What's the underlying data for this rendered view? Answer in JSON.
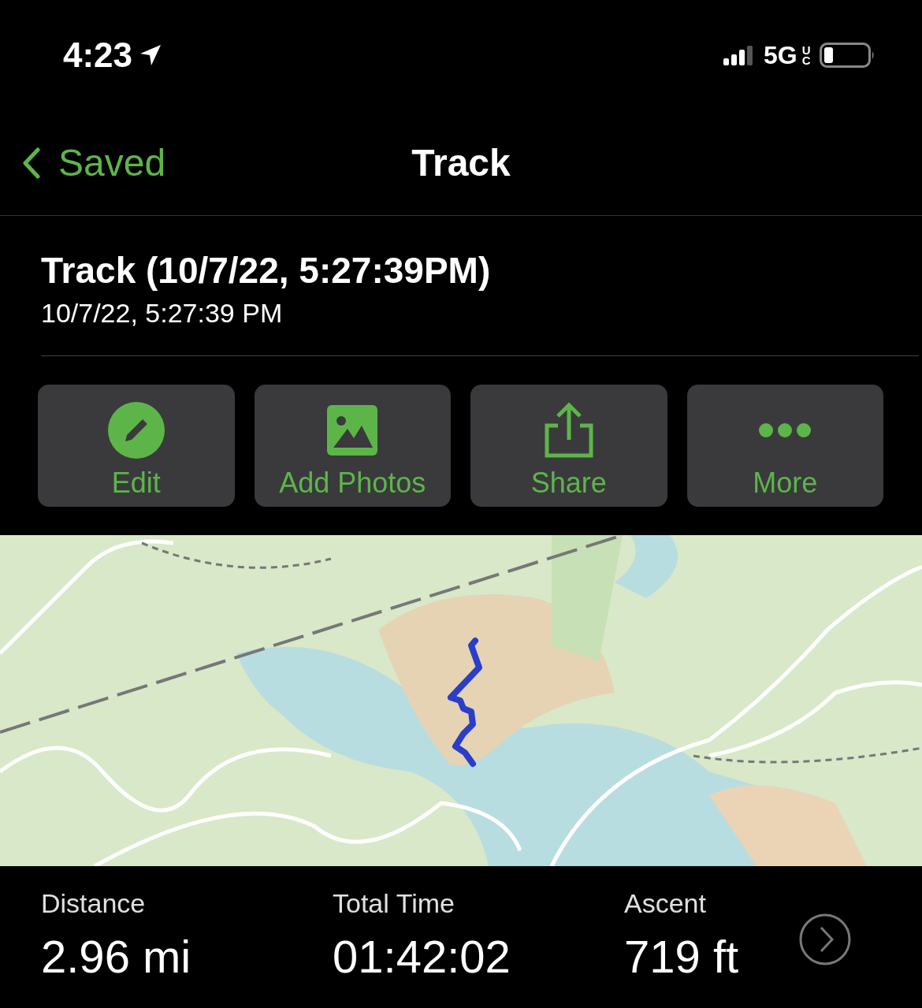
{
  "status_bar": {
    "time": "4:23",
    "network": "5G",
    "network_badge": "UC"
  },
  "nav_bar": {
    "back_label": "Saved",
    "title": "Track"
  },
  "header": {
    "title": "Track (10/7/22, 5:27:39PM)",
    "subtitle": "10/7/22, 5:27:39 PM"
  },
  "actions": [
    {
      "kind": "edit",
      "label": "Edit"
    },
    {
      "kind": "photos",
      "label": "Add Photos"
    },
    {
      "kind": "share",
      "label": "Share"
    },
    {
      "kind": "more",
      "label": "More"
    }
  ],
  "stats": [
    {
      "label": "Distance",
      "value": "2.96 mi"
    },
    {
      "label": "Total Time",
      "value": "01:42:02"
    },
    {
      "label": "Ascent",
      "value": "719 ft"
    }
  ]
}
